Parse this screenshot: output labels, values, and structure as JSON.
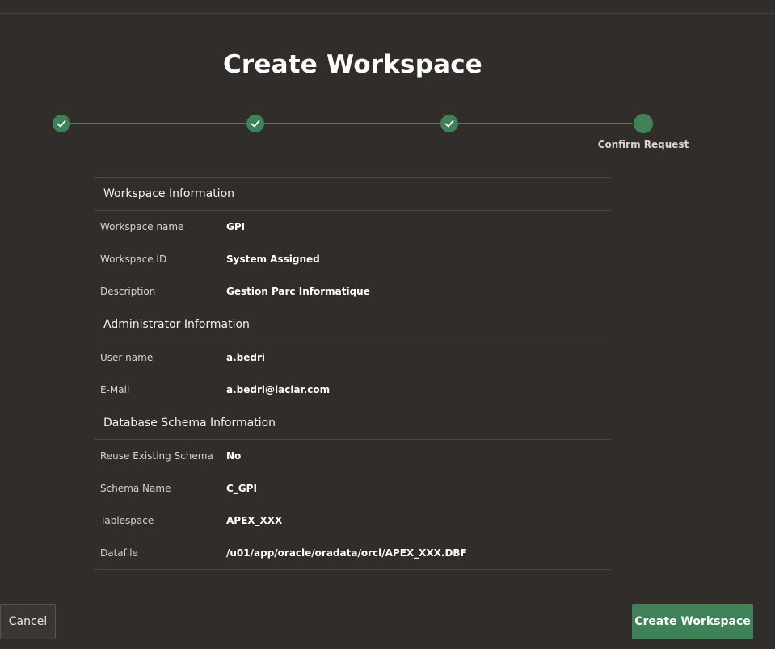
{
  "title": "Create Workspace",
  "wizard": {
    "steps": [
      {
        "state": "done",
        "icon": "check-icon"
      },
      {
        "state": "done",
        "icon": "check-icon"
      },
      {
        "state": "done",
        "icon": "check-icon"
      },
      {
        "state": "current",
        "label": "Confirm Request"
      }
    ]
  },
  "sections": [
    {
      "header": "Workspace Information",
      "rows": [
        {
          "label": "Workspace name",
          "value": "GPI"
        },
        {
          "label": "Workspace ID",
          "value": "System Assigned"
        },
        {
          "label": "Description",
          "value": "Gestion Parc Informatique"
        }
      ]
    },
    {
      "header": "Administrator Information",
      "rows": [
        {
          "label": "User name",
          "value": "a.bedri"
        },
        {
          "label": "E-Mail",
          "value": "a.bedri@laciar.com"
        }
      ]
    },
    {
      "header": "Database Schema Information",
      "rows": [
        {
          "label": "Reuse Existing Schema",
          "value": "No"
        },
        {
          "label": "Schema Name",
          "value": "C_GPI"
        },
        {
          "label": "Tablespace",
          "value": "APEX_XXX"
        },
        {
          "label": "Datafile",
          "value": "/u01/app/oracle/oradata/orcl/APEX_XXX.DBF"
        }
      ]
    }
  ],
  "buttons": {
    "cancel": "Cancel",
    "create": "Create Workspace"
  },
  "colors": {
    "background": "#312d2a",
    "accent": "#3f8257"
  }
}
